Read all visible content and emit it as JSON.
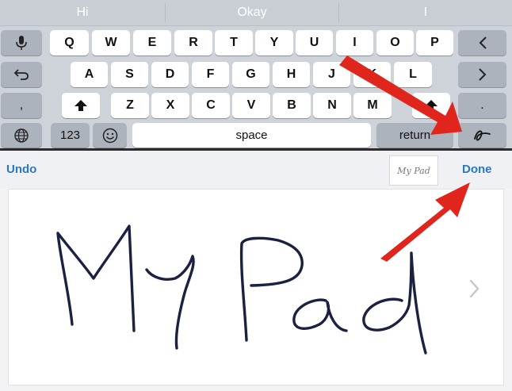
{
  "suggestions": [
    "Hi",
    "Okay",
    "I"
  ],
  "keyboard": {
    "row1": [
      "Q",
      "W",
      "E",
      "R",
      "T",
      "Y",
      "U",
      "I",
      "O",
      "P"
    ],
    "row2": [
      "A",
      "S",
      "D",
      "F",
      "G",
      "H",
      "J",
      "K",
      "L"
    ],
    "row3": [
      "Z",
      "X",
      "C",
      "V",
      "B",
      "N",
      "M"
    ],
    "comma": ",",
    "period": ".",
    "numbers_label": "123",
    "space_label": "space",
    "return_label": "return"
  },
  "toolbar": {
    "undo_label": "Undo",
    "done_label": "Done",
    "preview_text": "My Pad"
  },
  "handwriting": {
    "text": "My Pad"
  },
  "colors": {
    "accent": "#2a78c5",
    "annotation_arrow": "#e0261c",
    "ink": "#1b2140"
  },
  "icons": [
    "microphone-icon",
    "backspace-icon",
    "undo-arrow-icon",
    "arrow-right-icon",
    "shift-icon",
    "globe-icon",
    "emoji-icon",
    "handwriting-icon",
    "chevron-right-icon"
  ]
}
